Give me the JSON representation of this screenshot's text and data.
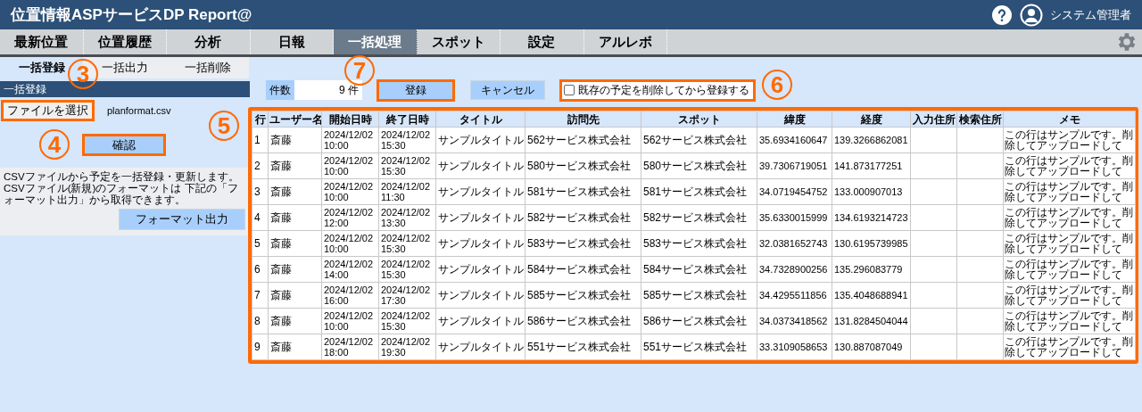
{
  "header": {
    "title": "位置情報ASPサービスDP Report@",
    "user": "システム管理者"
  },
  "nav": [
    {
      "label": "最新位置",
      "selected": false
    },
    {
      "label": "位置履歴",
      "selected": false
    },
    {
      "label": "分析",
      "selected": false
    },
    {
      "label": "日報",
      "selected": false
    },
    {
      "label": "一括処理",
      "selected": true
    },
    {
      "label": "スポット",
      "selected": false
    },
    {
      "label": "設定",
      "selected": false
    },
    {
      "label": "アルレボ",
      "selected": false
    }
  ],
  "subtabs": [
    {
      "label": "一括登録",
      "selected": true
    },
    {
      "label": "一括出力",
      "selected": false
    },
    {
      "label": "一括削除",
      "selected": false
    }
  ],
  "left_panel": {
    "section_title": "一括登録",
    "file_button": "ファイルを選択",
    "file_name": "planformat.csv",
    "confirm_button": "確認",
    "description": "CSVファイルから予定を一括登録・更新します。CSVファイル(新規)のフォーマットは 下記の「フォーマット出力」から取得できます。",
    "format_button": "フォーマット出力"
  },
  "controls": {
    "count_label": "件数",
    "count_value": "9 件",
    "register_button": "登録",
    "cancel_button": "キャンセル",
    "delete_existing": {
      "label": "既存の予定を削除してから登録する",
      "checked": false
    }
  },
  "annotations": [
    "3",
    "4",
    "5",
    "6",
    "7"
  ],
  "table": {
    "columns": [
      "行",
      "ユーザー名",
      "開始日時",
      "終了日時",
      "タイトル",
      "訪問先",
      "スポット",
      "緯度",
      "経度",
      "入力住所",
      "検索住所",
      "メモ"
    ],
    "rows": [
      [
        "1",
        "斎藤",
        "2024/12/02 10:00",
        "2024/12/02 15:30",
        "サンプルタイトル",
        "562サービス株式会社",
        "562サービス株式会社",
        "35.6934160647",
        "139.3266862081",
        "",
        "",
        "この行はサンプルです。削除してアップロードして"
      ],
      [
        "2",
        "斎藤",
        "2024/12/02 10:00",
        "2024/12/02 15:30",
        "サンプルタイトル",
        "580サービス株式会社",
        "580サービス株式会社",
        "39.7306719051",
        "141.873177251",
        "",
        "",
        "この行はサンプルです。削除してアップロードして"
      ],
      [
        "3",
        "斎藤",
        "2024/12/02 10:00",
        "2024/12/02 11:30",
        "サンプルタイトル",
        "581サービス株式会社",
        "581サービス株式会社",
        "34.0719454752",
        "133.000907013",
        "",
        "",
        "この行はサンプルです。削除してアップロードして"
      ],
      [
        "4",
        "斎藤",
        "2024/12/02 12:00",
        "2024/12/02 13:30",
        "サンプルタイトル",
        "582サービス株式会社",
        "582サービス株式会社",
        "35.6330015999",
        "134.6193214723",
        "",
        "",
        "この行はサンプルです。削除してアップロードして"
      ],
      [
        "5",
        "斎藤",
        "2024/12/02 10:00",
        "2024/12/02 15:30",
        "サンプルタイトル",
        "583サービス株式会社",
        "583サービス株式会社",
        "32.0381652743",
        "130.6195739985",
        "",
        "",
        "この行はサンプルです。削除してアップロードして"
      ],
      [
        "6",
        "斎藤",
        "2024/12/02 14:00",
        "2024/12/02 15:30",
        "サンプルタイトル",
        "584サービス株式会社",
        "584サービス株式会社",
        "34.7328900256",
        "135.296083779",
        "",
        "",
        "この行はサンプルです。削除してアップロードして"
      ],
      [
        "7",
        "斎藤",
        "2024/12/02 16:00",
        "2024/12/02 17:30",
        "サンプルタイトル",
        "585サービス株式会社",
        "585サービス株式会社",
        "34.4295511856",
        "135.4048688941",
        "",
        "",
        "この行はサンプルです。削除してアップロードして"
      ],
      [
        "8",
        "斎藤",
        "2024/12/02 10:00",
        "2024/12/02 15:30",
        "サンプルタイトル",
        "586サービス株式会社",
        "586サービス株式会社",
        "34.0373418562",
        "131.8284504044",
        "",
        "",
        "この行はサンプルです。削除してアップロードして"
      ],
      [
        "9",
        "斎藤",
        "2024/12/02 18:00",
        "2024/12/02 19:30",
        "サンプルタイトル",
        "551サービス株式会社",
        "551サービス株式会社",
        "33.3109058653",
        "130.887087049",
        "",
        "",
        "この行はサンプルです。削除してアップロードして"
      ]
    ]
  }
}
